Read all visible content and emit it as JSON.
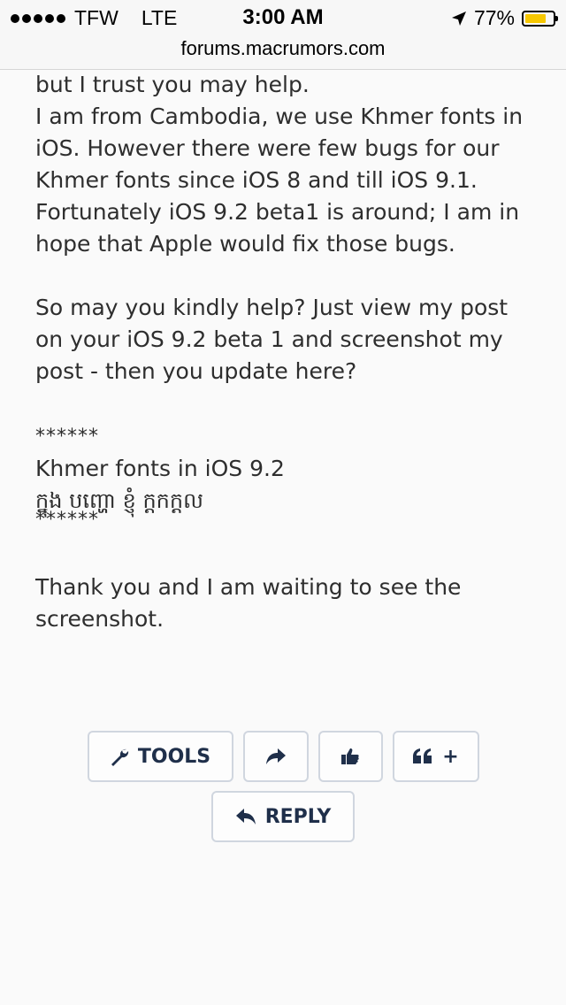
{
  "status_bar": {
    "carrier": "TFW",
    "network": "LTE",
    "time": "3:00 AM",
    "battery_percent": "77%",
    "battery_level": 0.77,
    "battery_color": "#f6c700"
  },
  "url_bar": {
    "domain": "forums.macrumors.com"
  },
  "post": {
    "lines": [
      "but I trust you may help.",
      "I am from Cambodia, we use Khmer fonts in iOS. However there were few bugs for our Khmer fonts since iOS 8 and till iOS 9.1.",
      "Fortunately iOS 9.2 beta1 is around; I am in hope that Apple would fix those bugs.",
      "So may you kindly help? Just view my post on your iOS 9.2 beta 1 and screenshot my post - then you update here?",
      "******",
      "Khmer fonts in iOS 9.2",
      "ក្នុង បញ្ហោ ខ្ញុំ ក្តកក្តល",
      "******",
      "Thank you and I am waiting to see the screenshot."
    ]
  },
  "actions": {
    "tools_label": "TOOLS",
    "reply_label": "REPLY",
    "multiquote_plus": "+"
  },
  "icons": {
    "location": "location-arrow-icon",
    "tools": "wrench-icon",
    "share": "share-arrow-icon",
    "like": "thumbs-up-icon",
    "quote": "quote-icon",
    "reply": "reply-arrow-icon"
  }
}
